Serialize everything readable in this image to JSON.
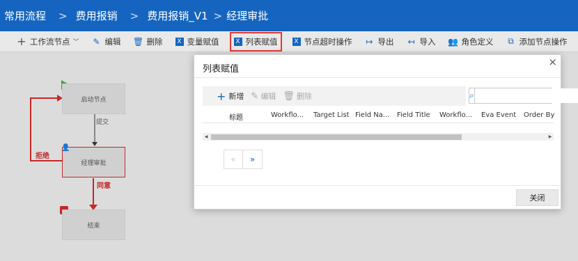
{
  "breadcrumb": {
    "items": [
      "常用流程",
      "费用报销",
      "费用报销_V1",
      "经理审批"
    ],
    "separators": [
      ">",
      ">",
      ">"
    ]
  },
  "toolbar": {
    "items": [
      {
        "label": "工作流节点",
        "icon": "plus-icon",
        "has_dropdown": true
      },
      {
        "label": "编辑",
        "icon": "pencil-icon"
      },
      {
        "label": "删除",
        "icon": "trash-icon"
      },
      {
        "label": "变量赋值",
        "icon": "excel-icon"
      },
      {
        "label": "列表赋值",
        "icon": "excel-icon",
        "active": true
      },
      {
        "label": "节点超时操作",
        "icon": "excel-icon"
      },
      {
        "label": "导出",
        "icon": "export-icon"
      },
      {
        "label": "导入",
        "icon": "import-icon"
      },
      {
        "label": "角色定义",
        "icon": "users-icon"
      },
      {
        "label": "添加节点操作",
        "icon": "add-op-icon"
      }
    ]
  },
  "workflow": {
    "nodes": {
      "start": "启动节点",
      "manager": "经理审批",
      "end": "结束"
    },
    "edges": {
      "submit": "提交",
      "reject": "拒绝",
      "approve": "同意"
    },
    "colors": {
      "reject": "#c62828",
      "approve": "#c62828",
      "start_marker": "#43a047",
      "end_marker": "#c62828"
    }
  },
  "dialog": {
    "title": "列表赋值",
    "close_symbol": "×",
    "buttons": {
      "add": "新增",
      "edit": "编辑",
      "delete": "删除"
    },
    "search": {
      "placeholder": "",
      "value": ""
    },
    "columns": [
      "标题",
      "Workflo...",
      "Target List",
      "Field Na...",
      "Field Title",
      "Workflo...",
      "Eva Event",
      "Order By"
    ],
    "pager": {
      "prev": "«",
      "next": "»"
    },
    "close_label": "关闭"
  },
  "colors": {
    "header_bg": "#1565c0",
    "accent": "#1565c0",
    "highlight": "#e53935"
  }
}
